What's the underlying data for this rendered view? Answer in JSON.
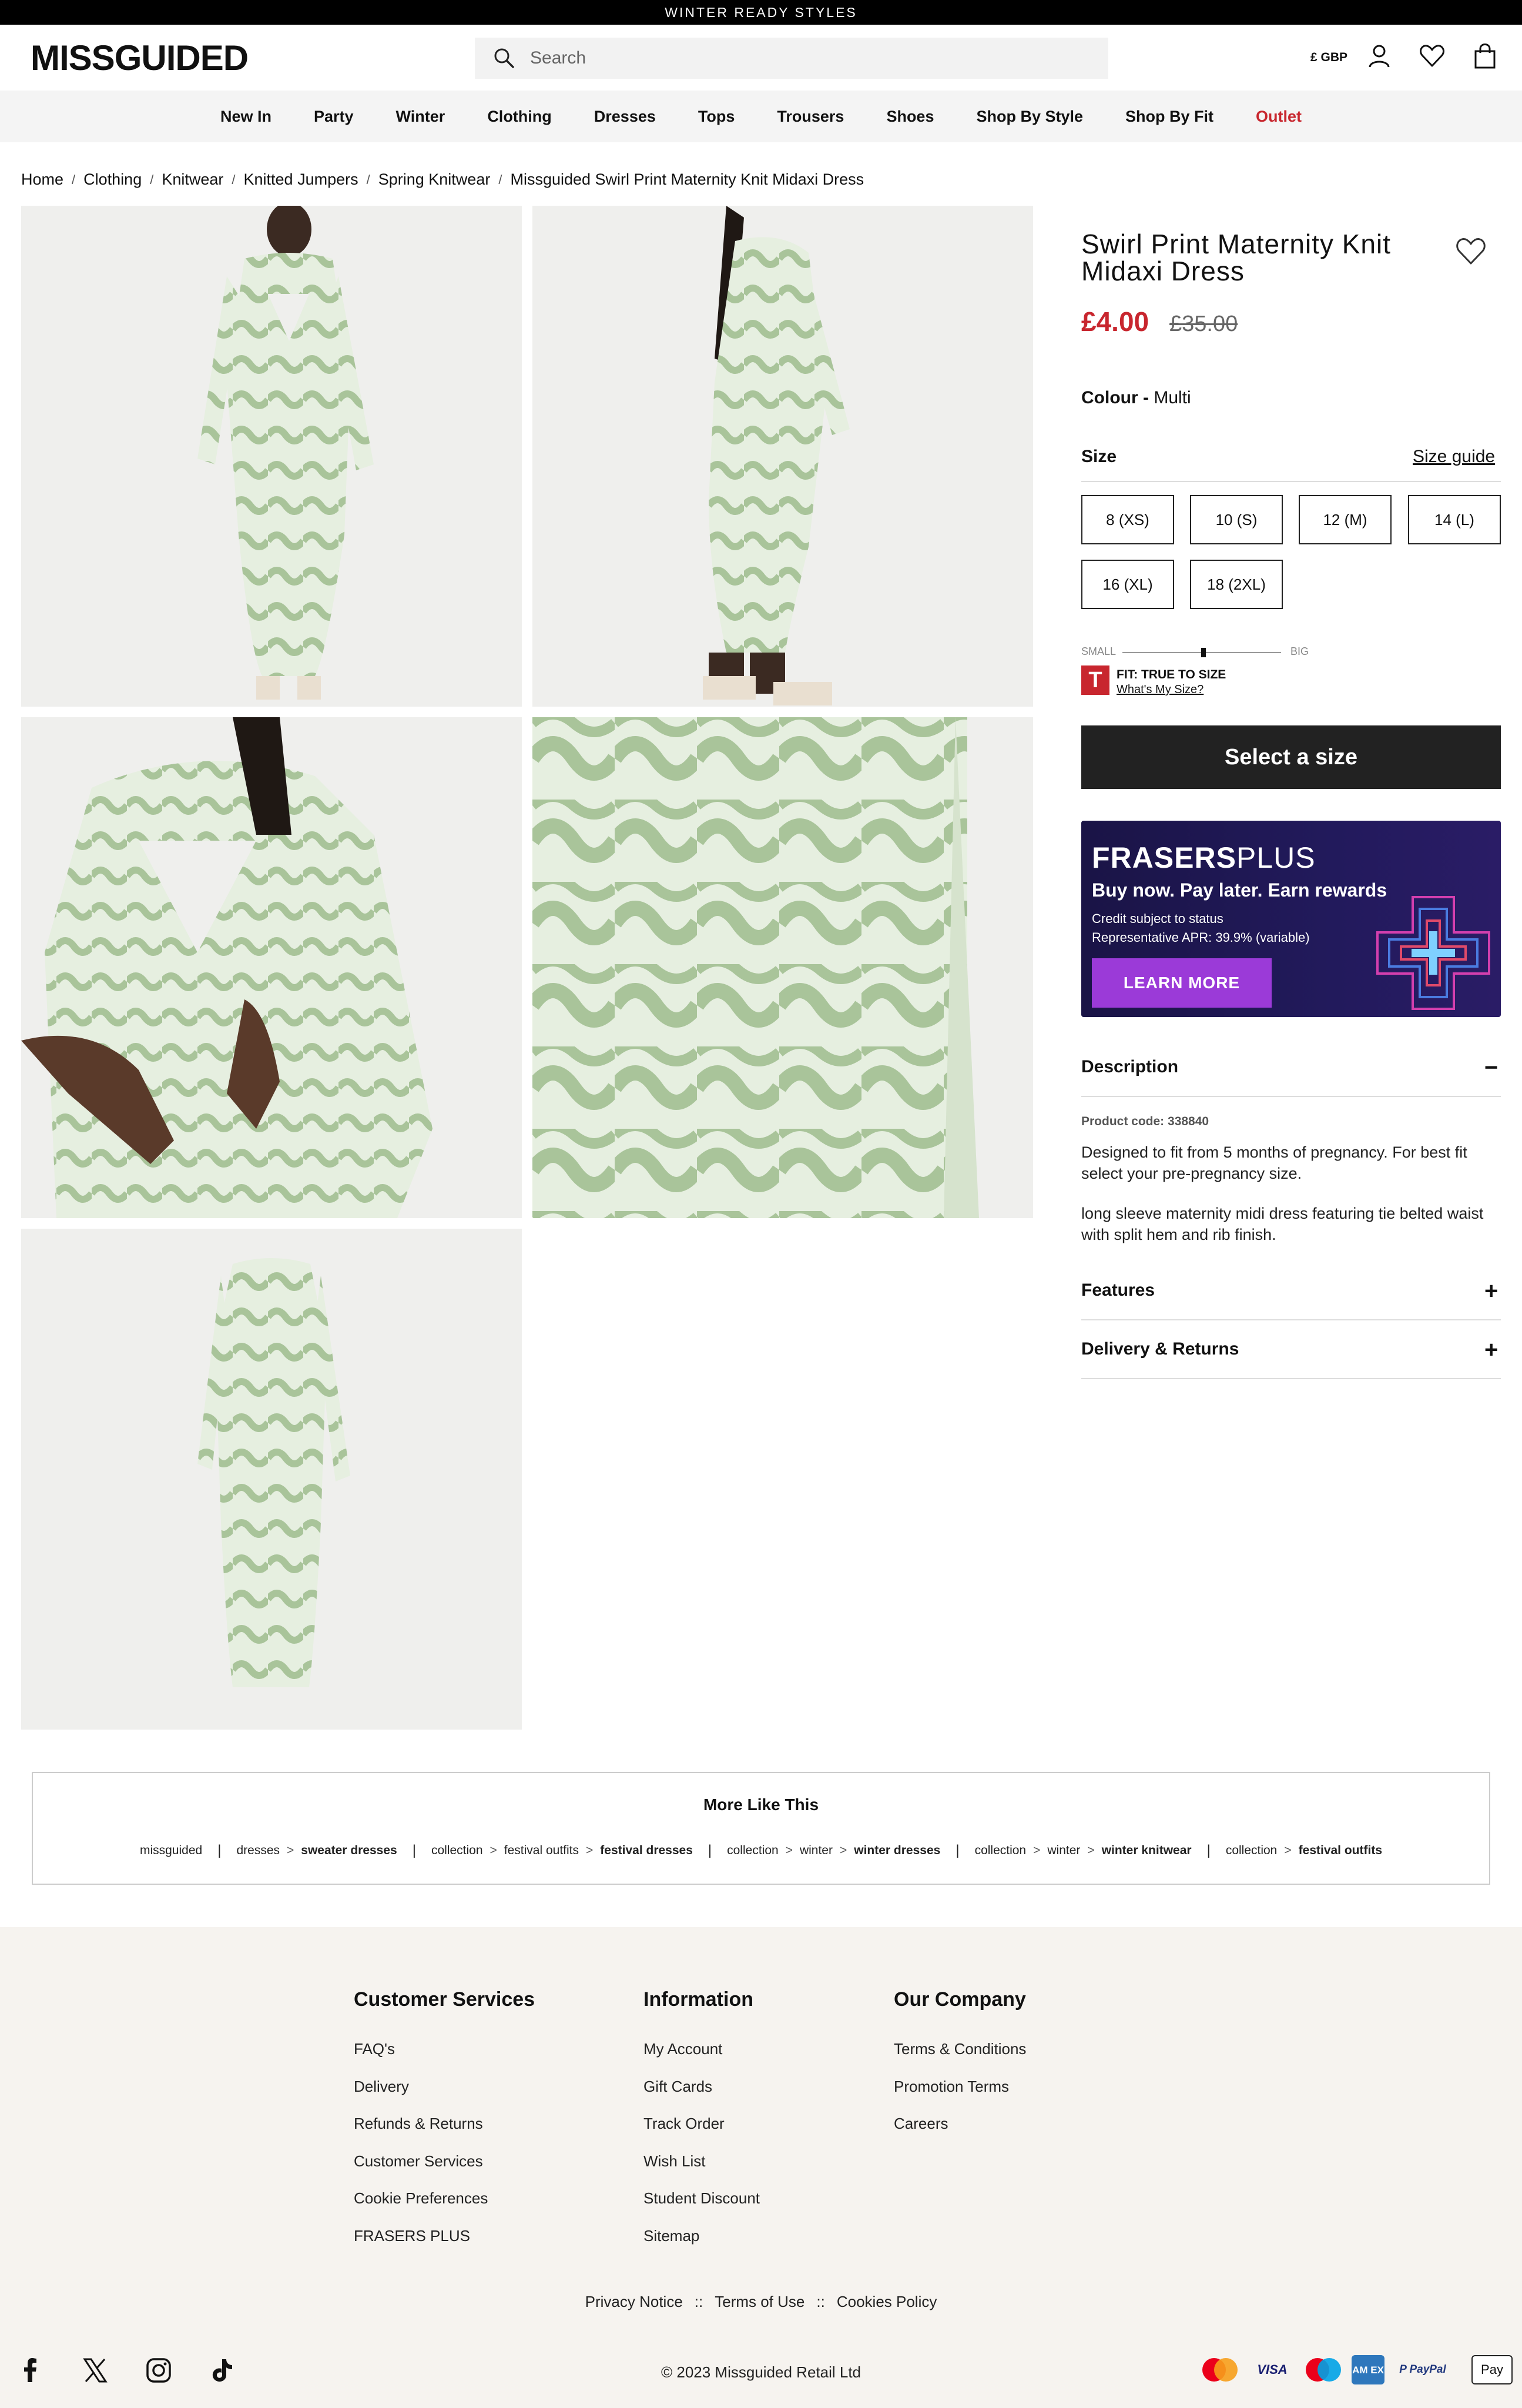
{
  "promo": {
    "text": "WINTER READY STYLES"
  },
  "header": {
    "logo": "MISSGUIDED",
    "search_placeholder": "Search",
    "currency": "£ GBP"
  },
  "nav": {
    "items": [
      "New In",
      "Party",
      "Winter",
      "Clothing",
      "Dresses",
      "Tops",
      "Trousers",
      "Shoes",
      "Shop By Style",
      "Shop By Fit",
      "Outlet"
    ]
  },
  "breadcrumb": [
    "Home",
    "Clothing",
    "Knitwear",
    "Knitted Jumpers",
    "Spring Knitwear",
    "Missguided Swirl Print Maternity Knit Midaxi Dress"
  ],
  "product": {
    "title_line1": "Swirl Print Maternity Knit",
    "title_line2": "Midaxi Dress",
    "price_now": "£4.00",
    "price_was": "£35.00",
    "colour_label": "Colour -",
    "colour_value": "Multi",
    "size_label": "Size",
    "size_guide": "Size guide",
    "sizes": [
      "8 (XS)",
      "10 (S)",
      "12 (M)",
      "14 (L)",
      "16 (XL)",
      "18 (2XL)"
    ],
    "fit_small": "SMALL",
    "fit_big": "BIG",
    "fit_badge": "T",
    "fit_text": "FIT: TRUE TO SIZE",
    "fit_link": "What's My Size?",
    "select_button": "Select a size"
  },
  "frasers": {
    "brand_bold": "FRASERS",
    "brand_light": "PLUS",
    "headline": "Buy now. Pay later. Earn rewards",
    "line1": "Credit subject to status",
    "line2": "Representative APR: 39.9% (variable)",
    "button": "LEARN MORE"
  },
  "accordions": {
    "description_title": "Description",
    "description_sign": "−",
    "product_code": "Product code: 338840",
    "desc_p1_l1": "Designed to fit from 5 months of pregnancy. For best fit",
    "desc_p1_l2": "select your pre-pregnancy size.",
    "desc_p2_l1": "long sleeve maternity midi dress featuring tie belted waist",
    "desc_p2_l2": "with split hem and rib finish.",
    "features_title": "Features",
    "features_sign": "+",
    "delivery_title": "Delivery & Returns",
    "delivery_sign": "+"
  },
  "more_like_this": {
    "title": "More Like This",
    "groups": [
      {
        "parts": [
          "missguided"
        ],
        "bold": ""
      },
      {
        "parts": [
          "dresses"
        ],
        "bold": "sweater dresses"
      },
      {
        "parts": [
          "collection",
          "festival outfits"
        ],
        "bold": "festival dresses"
      },
      {
        "parts": [
          "collection",
          "winter"
        ],
        "bold": "winter dresses"
      },
      {
        "parts": [
          "collection",
          "winter"
        ],
        "bold": "winter knitwear"
      },
      {
        "parts": [
          "collection"
        ],
        "bold": "festival outfits"
      }
    ]
  },
  "footer": {
    "col1_title": "Customer Services",
    "col1": [
      "FAQ's",
      "Delivery",
      "Refunds & Returns",
      "Customer Services",
      "Cookie Preferences",
      "FRASERS PLUS"
    ],
    "col2_title": "Information",
    "col2": [
      "My Account",
      "Gift Cards",
      "Track Order",
      "Wish List",
      "Student Discount",
      "Sitemap"
    ],
    "col3_title": "Our Company",
    "col3": [
      "Terms & Conditions",
      "Promotion Terms",
      "Careers"
    ],
    "legal": [
      "Privacy Notice",
      "Terms of Use",
      "Cookies Policy"
    ],
    "legal_sep": "::",
    "copyright": "© 2023 Missguided Retail Ltd",
    "payments": [
      "VISA",
      "AM EX",
      "P PayPal",
      "Pay"
    ]
  },
  "colors": {
    "accent_red": "#c8262e",
    "dress_green": "#a9c49a",
    "dress_light": "#e6efe0",
    "frasers_purple": "#9b3ad8"
  },
  "icons": [
    "search-icon",
    "account-icon",
    "wishlist-heart-icon",
    "bag-icon",
    "facebook-icon",
    "x-icon",
    "instagram-icon",
    "tiktok-icon"
  ]
}
